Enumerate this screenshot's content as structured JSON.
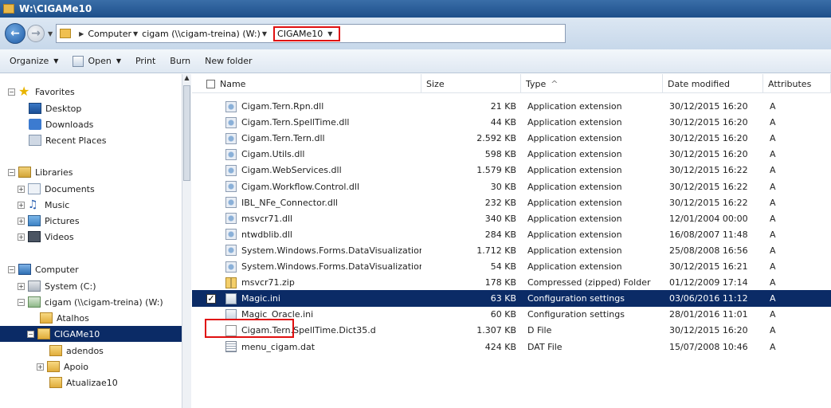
{
  "window": {
    "title": "W:\\CIGAMe10"
  },
  "address": {
    "crumbs": [
      "Computer",
      "cigam (\\\\cigam-treina) (W:)",
      "CIGAMe10"
    ]
  },
  "toolbar": {
    "organize_label": "Organize",
    "open_label": "Open",
    "print_label": "Print",
    "burn_label": "Burn",
    "new_folder_label": "New folder"
  },
  "nav": {
    "favorites": "Favorites",
    "desktop": "Desktop",
    "downloads": "Downloads",
    "recent_places": "Recent Places",
    "libraries": "Libraries",
    "documents": "Documents",
    "music": "Music",
    "pictures": "Pictures",
    "videos": "Videos",
    "computer": "Computer",
    "system_c": "System (C:)",
    "cigam_w": "cigam (\\\\cigam-treina) (W:)",
    "atalhos": "Atalhos",
    "cigame10": "CIGAMe10",
    "adendos": "adendos",
    "apoio": "Apoio",
    "atualizae10": "Atualizae10"
  },
  "columns": {
    "name": "Name",
    "size": "Size",
    "type": "Type",
    "type_sort": "^",
    "date": "Date modified",
    "attributes": "Attributes"
  },
  "files": [
    {
      "name": "Cigam.Tern.Rpn.dll",
      "size": "21 KB",
      "type": "Application extension",
      "date": "30/12/2015 16:20",
      "attr": "A",
      "icon": "dll"
    },
    {
      "name": "Cigam.Tern.SpellTime.dll",
      "size": "44 KB",
      "type": "Application extension",
      "date": "30/12/2015 16:20",
      "attr": "A",
      "icon": "dll"
    },
    {
      "name": "Cigam.Tern.Tern.dll",
      "size": "2.592 KB",
      "type": "Application extension",
      "date": "30/12/2015 16:20",
      "attr": "A",
      "icon": "dll"
    },
    {
      "name": "Cigam.Utils.dll",
      "size": "598 KB",
      "type": "Application extension",
      "date": "30/12/2015 16:20",
      "attr": "A",
      "icon": "dll"
    },
    {
      "name": "Cigam.WebServices.dll",
      "size": "1.579 KB",
      "type": "Application extension",
      "date": "30/12/2015 16:22",
      "attr": "A",
      "icon": "dll"
    },
    {
      "name": "Cigam.Workflow.Control.dll",
      "size": "30 KB",
      "type": "Application extension",
      "date": "30/12/2015 16:22",
      "attr": "A",
      "icon": "dll"
    },
    {
      "name": "IBL_NFe_Connector.dll",
      "size": "232 KB",
      "type": "Application extension",
      "date": "30/12/2015 16:22",
      "attr": "A",
      "icon": "dll"
    },
    {
      "name": "msvcr71.dll",
      "size": "340 KB",
      "type": "Application extension",
      "date": "12/01/2004 00:00",
      "attr": "A",
      "icon": "dll"
    },
    {
      "name": "ntwdblib.dll",
      "size": "284 KB",
      "type": "Application extension",
      "date": "16/08/2007 11:48",
      "attr": "A",
      "icon": "dll"
    },
    {
      "name": "System.Windows.Forms.DataVisualization...",
      "size": "1.712 KB",
      "type": "Application extension",
      "date": "25/08/2008 16:56",
      "attr": "A",
      "icon": "dll"
    },
    {
      "name": "System.Windows.Forms.DataVisualization...",
      "size": "54 KB",
      "type": "Application extension",
      "date": "30/12/2015 16:21",
      "attr": "A",
      "icon": "dll"
    },
    {
      "name": "msvcr71.zip",
      "size": "178 KB",
      "type": "Compressed (zipped) Folder",
      "date": "01/12/2009 17:14",
      "attr": "A",
      "icon": "zip"
    },
    {
      "name": "Magic.ini",
      "size": "63 KB",
      "type": "Configuration settings",
      "date": "03/06/2016 11:12",
      "attr": "A",
      "icon": "ini",
      "selected": true,
      "checkmark": "✓"
    },
    {
      "name": "Magic_Oracle.ini",
      "size": "60 KB",
      "type": "Configuration settings",
      "date": "28/01/2016 11:01",
      "attr": "A",
      "icon": "ini"
    },
    {
      "name": "Cigam.Tern.SpellTime.Dict35.d",
      "size": "1.307 KB",
      "type": "D File",
      "date": "30/12/2015 16:20",
      "attr": "A",
      "icon": "file"
    },
    {
      "name": "menu_cigam.dat",
      "size": "424 KB",
      "type": "DAT File",
      "date": "15/07/2008 10:46",
      "attr": "A",
      "icon": "dat"
    }
  ],
  "colors": {
    "selection": "#0b2b66",
    "highlight": "#e01010",
    "titlebar": "#1d4f8a"
  }
}
